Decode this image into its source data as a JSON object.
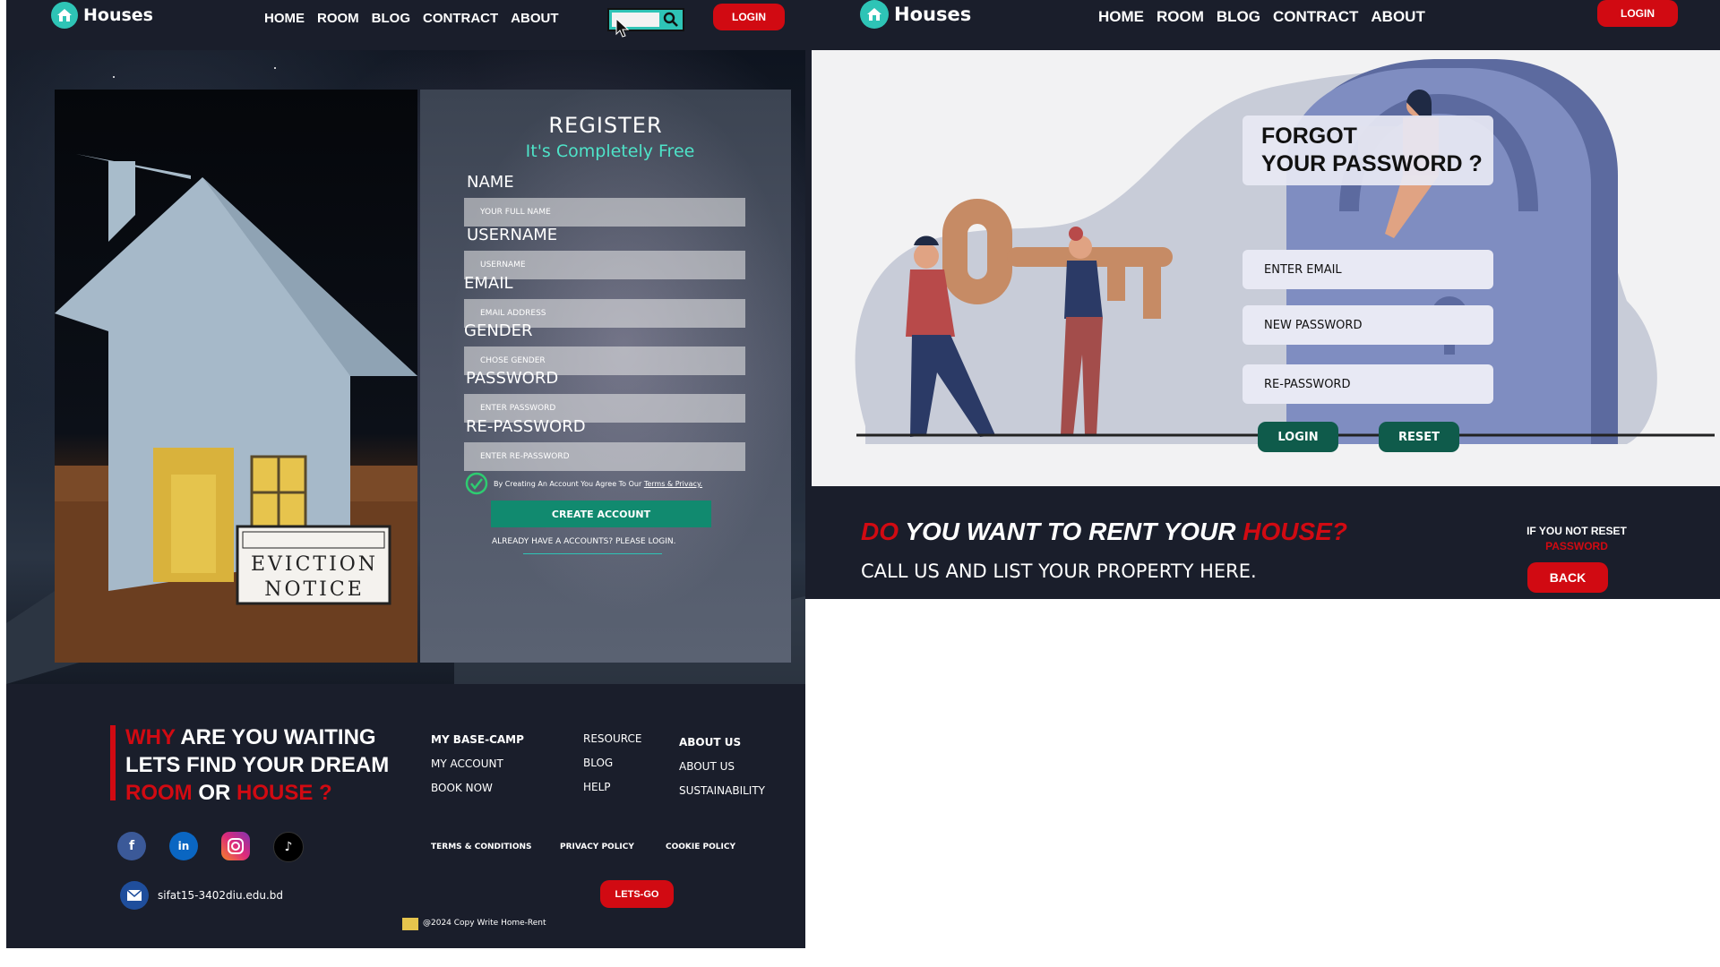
{
  "left": {
    "nav": {
      "brand": "Houses",
      "links": [
        "HOME",
        "ROOM",
        "BLOG",
        "CONTRACT",
        "ABOUT"
      ],
      "login": "LOGIN"
    },
    "photo": {
      "sign_line1": "EVICTION",
      "sign_line2": "NOTICE"
    },
    "register": {
      "title": "REGISTER",
      "subtitle": "It's Completely Free",
      "fields": [
        {
          "label": "NAME",
          "placeholder": "YOUR FULL NAME"
        },
        {
          "label": "USERNAME",
          "placeholder": "USERNAME"
        },
        {
          "label": "EMAIL",
          "placeholder": "EMAIL ADDRESS"
        },
        {
          "label": "GENDER",
          "placeholder": "CHOSE GENDER"
        },
        {
          "label": "PASSWORD",
          "placeholder": "ENTER PASSWORD"
        },
        {
          "label": "RE-PASSWORD",
          "placeholder": "ENTER RE-PASSWORD"
        }
      ],
      "terms_prefix": "By Creating An Account You Agree To Our ",
      "terms_link": "Terms & Privacy.",
      "create_button": "CREATE ACCOUNT",
      "already": "ALREADY HAVE A ACCOUNTS? PLEASE LOGIN."
    },
    "footer": {
      "headline": {
        "l1_red": "WHY",
        "l1_white": " ARE YOU WAITING",
        "l2": "LETS FIND YOUR DREAM",
        "l3_red1": "ROOM",
        "l3_white": " OR ",
        "l3_red2": "HOUSE ?"
      },
      "col1": [
        "MY BASE-CAMP",
        "MY ACCOUNT",
        "BOOK NOW"
      ],
      "col2": [
        "RESOURCE",
        "BLOG",
        "HELP"
      ],
      "col3": [
        "ABOUT US",
        "ABOUT US",
        "SUSTAINABILITY"
      ],
      "policies": [
        "TERMS & CONDITIONS",
        "PRIVACY POLICY",
        "COOKIE POLICY"
      ],
      "email": "sifat15-3402diu.edu.bd",
      "lets_go": "LETS-GO",
      "copyright": "@2024 Copy Write Home-Rent"
    }
  },
  "right": {
    "nav": {
      "brand": "Houses",
      "links": [
        "HOME",
        "ROOM",
        "BLOG",
        "CONTRACT",
        "ABOUT"
      ],
      "login": "LOGIN"
    },
    "forgot": {
      "title_l1": "FORGOT",
      "title_l2": "YOUR PASSWORD ?",
      "email_placeholder": "ENTER EMAIL",
      "new_password_placeholder": "NEW PASSWORD",
      "re_password_placeholder": "RE-PASSWORD",
      "login_button": "LOGIN",
      "reset_button": "RESET"
    },
    "bottom": {
      "head_red1": "DO",
      "head_white": " YOU WANT TO RENT YOUR ",
      "head_red2": "HOUSE?",
      "sub": "CALL US AND LIST YOUR PROPERTY HERE.",
      "reset_note_l1": "IF YOU NOT RESET",
      "reset_note_l2": "PASSWORD",
      "back_button": "BACK"
    }
  },
  "colors": {
    "accent_red": "#d10a12",
    "teal": "#2ec4b6",
    "dark_bg": "#1a1e2b",
    "green_button": "#118a6f"
  }
}
